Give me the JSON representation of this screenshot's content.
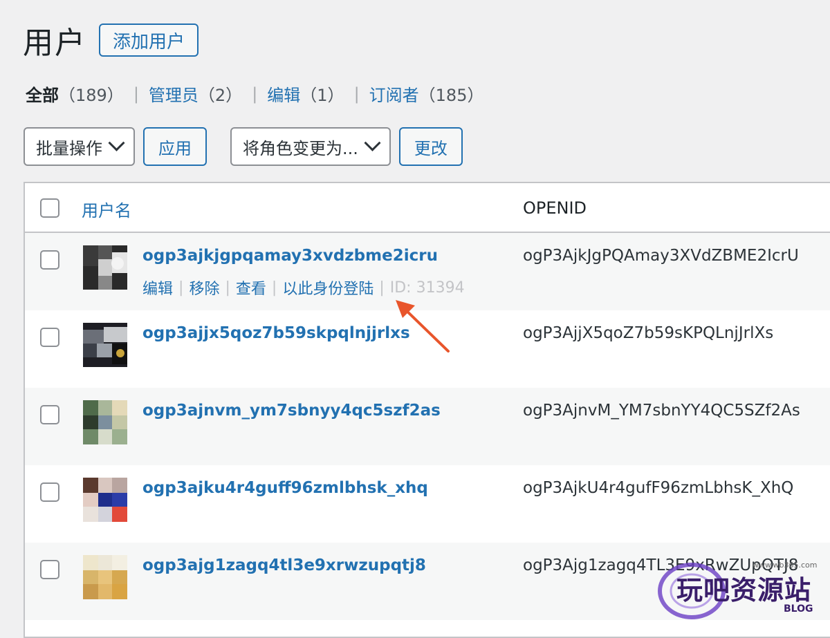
{
  "header": {
    "title": "用户",
    "add_button": "添加用户"
  },
  "filters": [
    {
      "label": "全部",
      "count": "（189）",
      "current": true
    },
    {
      "label": "管理员",
      "count": "（2）",
      "current": false
    },
    {
      "label": "编辑",
      "count": "（1）",
      "current": false
    },
    {
      "label": "订阅者",
      "count": "（185）",
      "current": false
    }
  ],
  "tablenav": {
    "bulk_select": "批量操作",
    "apply_button": "应用",
    "role_select": "将角色变更为...",
    "change_button": "更改"
  },
  "table": {
    "col_username": "用户名",
    "col_openid": "OPENID",
    "rows": [
      {
        "username": "ogp3ajkjgpqamay3xvdzbme2icru",
        "openid": "ogP3AjkJgPQAmay3XVdZBME2IcrU"
      },
      {
        "username": "ogp3ajjx5qoz7b59skpqlnjjrlxs",
        "openid": "ogP3AjjX5qoZ7b59sKPQLnjJrlXs"
      },
      {
        "username": "ogp3ajnvm_ym7sbnyy4qc5szf2as",
        "openid": "ogP3AjnvM_YM7sbnYY4QC5SZf2As"
      },
      {
        "username": "ogp3ajku4r4guff96zmlbhsk_xhq",
        "openid": "ogP3AjkU4r4gufF96zmLbhsK_XhQ"
      },
      {
        "username": "ogp3ajg1zagq4tl3e9xrwzupqtj8",
        "openid": "ogP3Ajg1zagq4TL3E9xRwZUpQTJ8"
      }
    ],
    "row_actions": {
      "edit": "编辑",
      "remove": "移除",
      "view": "查看",
      "login_as": "以此身份登陆",
      "id": "ID: 31394"
    }
  },
  "watermark": {
    "text": "玩吧资源站",
    "small": "www.wb365.com",
    "blog": "BLOG"
  },
  "colors": {
    "accent": "#2271b1",
    "arrow": "#e8552b",
    "background": "#f0f0f1"
  }
}
